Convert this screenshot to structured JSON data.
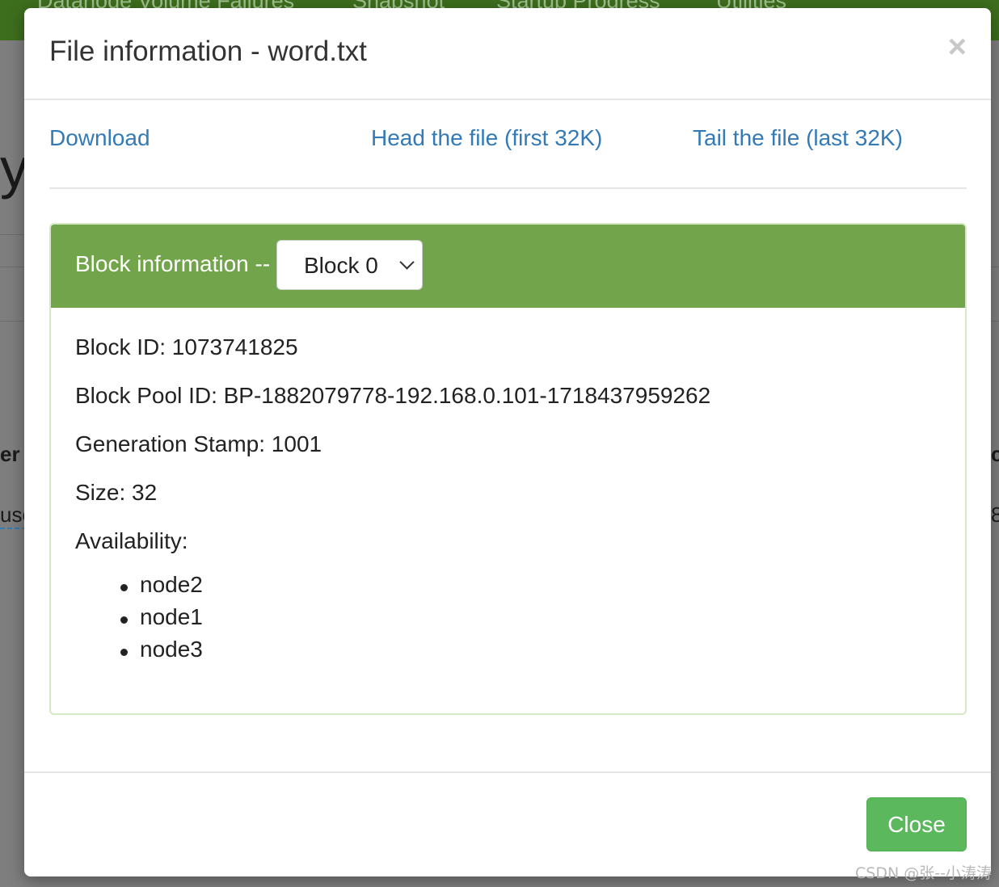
{
  "background": {
    "nav_items": [
      "Datanode Volume Failures",
      "Snapshot",
      "Startup Progress",
      "Utilities"
    ],
    "fragments": [
      "y",
      "er",
      "use",
      "c",
      "8"
    ]
  },
  "modal": {
    "title": "File information - word.txt",
    "close_icon": "×",
    "links": {
      "download": "Download",
      "head": "Head the file (first 32K)",
      "tail": "Tail the file (last 32K)"
    },
    "block_panel": {
      "label": "Block information --",
      "selected_block": "Block 0",
      "block_id": "Block ID: 1073741825",
      "block_pool_id": "Block Pool ID: BP-1882079778-192.168.0.101-1718437959262",
      "generation_stamp": "Generation Stamp: 1001",
      "size": "Size: 32",
      "availability_label": "Availability:",
      "nodes": [
        "node2",
        "node1",
        "node3"
      ]
    },
    "footer": {
      "close_label": "Close"
    }
  },
  "watermark": "CSDN @张--小涛涛",
  "colors": {
    "navbar": "#3d6e1d",
    "panel_heading": "#72a54b",
    "link": "#337ab7",
    "close_button": "#5cb85c"
  }
}
